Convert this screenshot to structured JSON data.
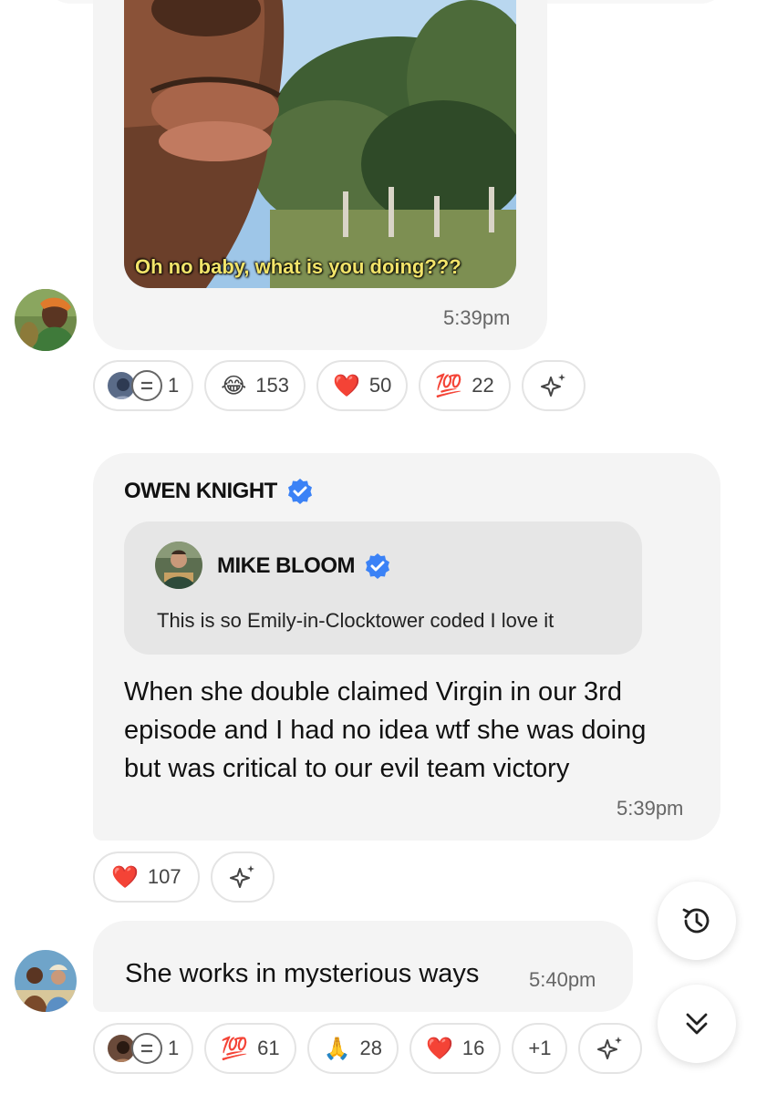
{
  "gif": {
    "caption": "Oh no baby, what is you doing???"
  },
  "message1": {
    "time": "5:39pm",
    "reactions": {
      "thread_count": "1",
      "joy": {
        "emoji": "😂",
        "count": "153"
      },
      "heart": {
        "emoji": "❤️",
        "count": "50"
      },
      "hundred": {
        "emoji": "💯",
        "count": "22"
      }
    }
  },
  "message2": {
    "author": "OWEN KNIGHT",
    "quote": {
      "author": "MIKE BLOOM",
      "text": "This is so Emily-in-Clocktower coded I love it"
    },
    "text": "When she double claimed Virgin in our 3rd episode and I had no idea wtf she was doing but was critical to our evil team victory",
    "time": "5:39pm",
    "reactions": {
      "heart": {
        "emoji": "❤️",
        "count": "107"
      }
    }
  },
  "message3": {
    "text": "She works in mysterious ways",
    "time": "5:40pm",
    "reactions": {
      "thread_count": "1",
      "hundred": {
        "emoji": "💯",
        "count": "61"
      },
      "pray": {
        "emoji": "🙏",
        "count": "28"
      },
      "heart": {
        "emoji": "❤️",
        "count": "16"
      },
      "more": "+1"
    }
  },
  "colors": {
    "verified": "#3b82f6",
    "bubble": "#f4f4f4",
    "quote_bg": "#e6e6e6",
    "heart": "#e0323b"
  },
  "icons": [
    "verified-badge-icon",
    "sparkle-icon",
    "history-icon",
    "chevron-double-down-icon",
    "thread-reply-icon"
  ]
}
